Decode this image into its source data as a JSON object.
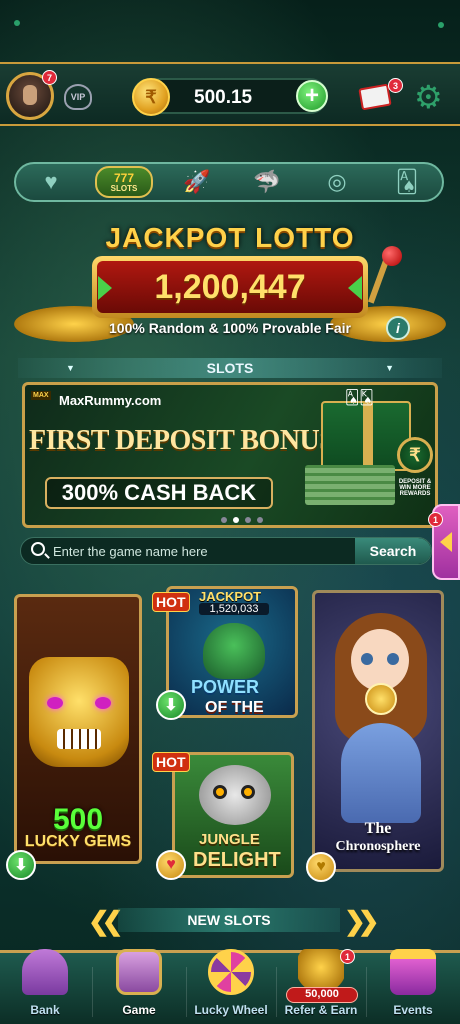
{
  "header": {
    "avatar_badge": "7",
    "vip_label": "VIP",
    "balance": "500.15",
    "mail_badge": "3"
  },
  "categories": {
    "active_top": "777",
    "active_label": "SLOTS",
    "icons": [
      "heart-icon",
      "slots-icon",
      "rocket-icon",
      "shark-icon",
      "roulette-icon",
      "cards-icon"
    ]
  },
  "jackpot": {
    "title": "JACKPOT LOTTO",
    "amount": "1,200,447",
    "subtitle": "100% Random & 100% Provable Fair",
    "info": "i"
  },
  "section": {
    "slots_title": "SLOTS"
  },
  "banner": {
    "logo": "MAX",
    "site": "MaxRummy.com",
    "title": "FIRST DEPOSIT BONUS",
    "cashback": "300% CASH BACK",
    "badge_text": "FIRST DEPOSIT",
    "rupee": "₹",
    "note": "DEPOSIT & WIN MORE REWARDS",
    "pages": 4,
    "active_page": 1
  },
  "side_tab": {
    "badge": "1"
  },
  "search": {
    "placeholder": "Enter the game name here",
    "button": "Search"
  },
  "games": {
    "lucky": {
      "line1": "500",
      "line2": "LUCKY GEMS"
    },
    "kraken": {
      "jackpot_label": "JACKPOT",
      "jackpot_value": "1,520,033",
      "line1": "POWER",
      "line2": "OF THE KRAKEN",
      "hot": "HOT"
    },
    "jungle": {
      "line1": "JUNGLE",
      "line2": "DELIGHT",
      "hot": "HOT"
    },
    "chrono": {
      "line1": "The",
      "line2": "Chronosphere"
    }
  },
  "new_slots": {
    "label": "NEW SLOTS"
  },
  "nav": {
    "items": [
      {
        "label": "Bank"
      },
      {
        "label": "Game"
      },
      {
        "label": "Lucky Wheel"
      },
      {
        "label": "Refer & Earn",
        "amount": "50,000",
        "badge": "1"
      },
      {
        "label": "Events"
      }
    ]
  },
  "colors": {
    "accent_gold": "#c9a050",
    "primary_green": "#1e5a4e",
    "jackpot_red": "#b01810"
  }
}
